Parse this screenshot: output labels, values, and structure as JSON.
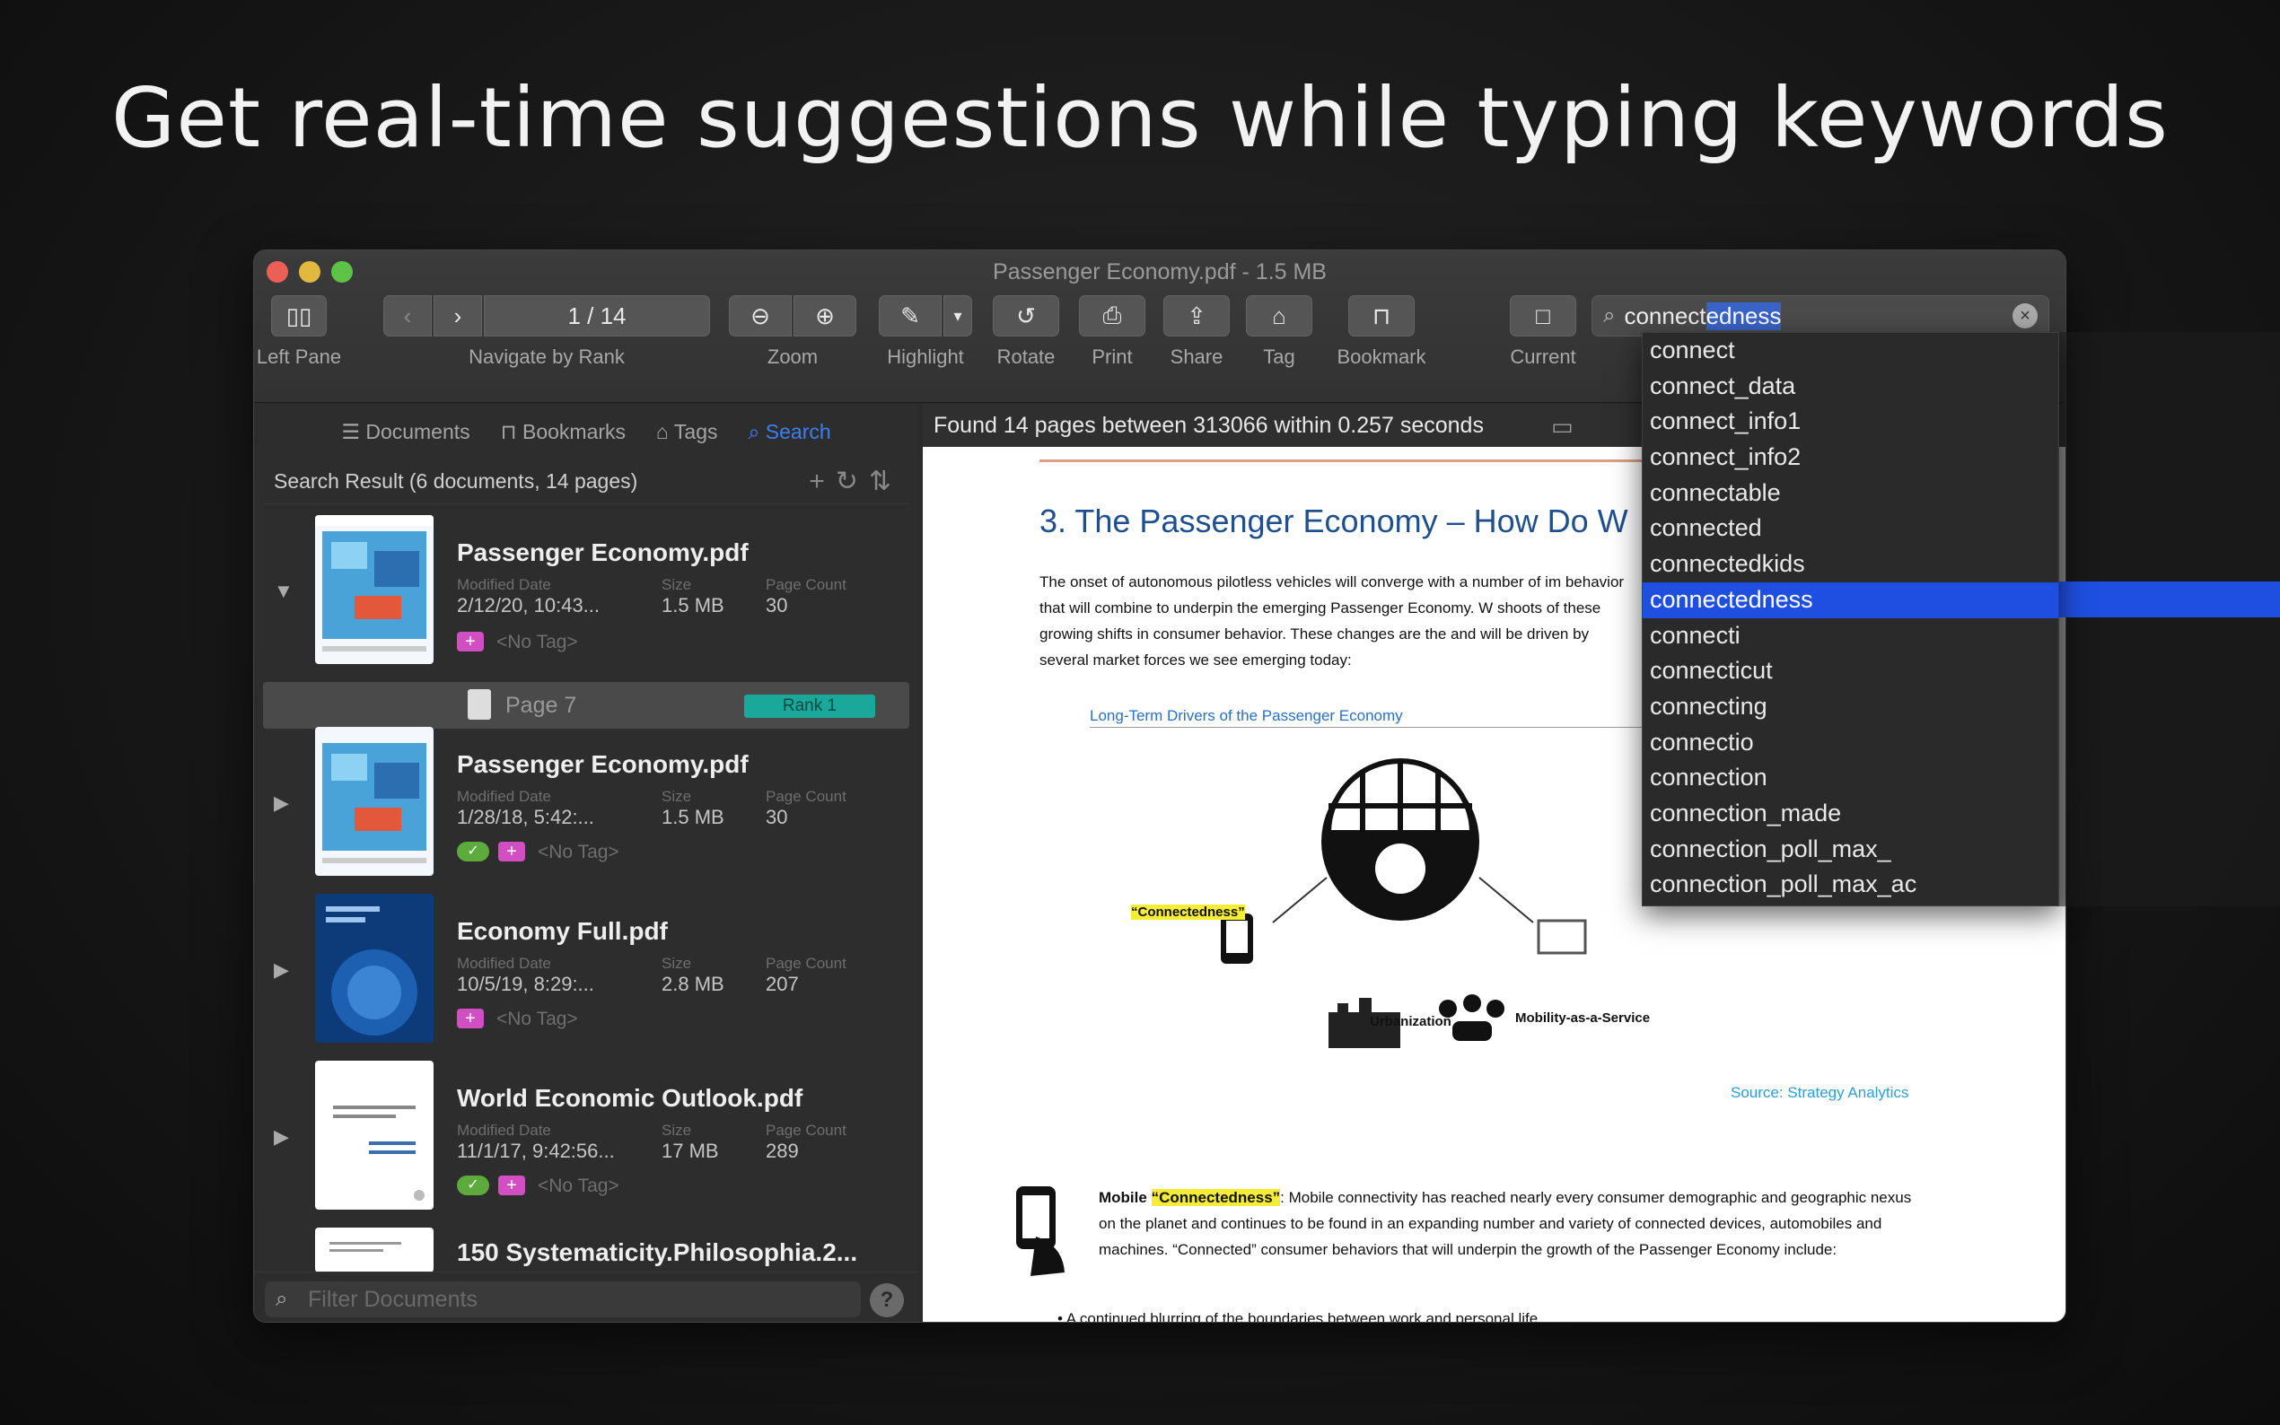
{
  "headline": "Get real-time suggestions while typing keywords",
  "window": {
    "title": "Passenger Economy.pdf - 1.5 MB"
  },
  "toolbar": {
    "left_pane": "Left Pane",
    "navigate": "Navigate by Rank",
    "page_indicator": "1 / 14",
    "zoom": "Zoom",
    "highlight": "Highlight",
    "rotate": "Rotate",
    "print": "Print",
    "share": "Share",
    "tag": "Tag",
    "bookmark": "Bookmark",
    "current": "Current"
  },
  "search": {
    "typed": "connect",
    "completion": "edness"
  },
  "left_pane": {
    "tabs": [
      "Documents",
      "Bookmarks",
      "Tags",
      "Search"
    ],
    "result_header": "Search Result (6 documents, 14 pages)",
    "meta_labels": [
      "Modified Date",
      "Size",
      "Page Count"
    ],
    "no_tag": "<No Tag>",
    "documents": [
      {
        "name": "Passenger Economy.pdf",
        "date": "2/12/20, 10:43...",
        "size": "1.5 MB",
        "pages": "30"
      },
      {
        "name": "Passenger Economy.pdf",
        "date": "1/28/18, 5:42:...",
        "size": "1.5 MB",
        "pages": "30"
      },
      {
        "name": "Economy Full.pdf",
        "date": "10/5/19, 8:29:...",
        "size": "2.8 MB",
        "pages": "207"
      },
      {
        "name": "World Economic Outlook.pdf",
        "date": "11/1/17, 9:42:56...",
        "size": "17 MB",
        "pages": "289"
      },
      {
        "name": "150 Systematicity.Philosophia.2...",
        "date": "",
        "size": "",
        "pages": ""
      }
    ],
    "page_row": {
      "page": "Page 7",
      "rank": "Rank 1"
    },
    "filter_placeholder": "Filter Documents"
  },
  "doc_view": {
    "found": "Found 14 pages between 313066 within 0.257 seconds",
    "heading": "3.  The Passenger Economy – How Do W",
    "body": "The onset of autonomous pilotless vehicles will converge with a number of im behavior that will combine to underpin the emerging Passenger Economy. W shoots of these growing shifts in consumer behavior. These changes are the and will be driven by several market forces we see emerging today:",
    "figure_title": "Long-Term Drivers of the Passenger Economy",
    "label_connectedness": "“Connectedness”",
    "label_urbanization": "Urbanization",
    "label_maas": "Mobility-as-a-Service",
    "source": "Source: Strategy Analytics",
    "para2_lead": "Mobile ",
    "para2_hl": "“Connectedness”",
    "para2_rest": ": Mobile connectivity has reached nearly every consumer demographic and geographic nexus on the planet and continues to be found in an expanding number and variety of connected devices, automobiles and machines. “Connected” consumer behaviors that will underpin the growth of the Passenger Economy include:",
    "bullet": "•        A continued blurring of the boundaries between work and personal life"
  },
  "suggestions": [
    "connect",
    "connect_data",
    "connect_info1",
    "connect_info2",
    "connectable",
    "connected",
    "connectedkids",
    "connectedness",
    "connecti",
    "connecticut",
    "connecting",
    "connectio",
    "connection",
    "connection_made",
    "connection_poll_max_",
    "connection_poll_max_ac"
  ],
  "selected_suggestion": 7,
  "colors": {
    "accent": "#1f4fe0",
    "tag": "#d24ec3",
    "rank": "#1aa89a",
    "highlight": "#f4ec35"
  }
}
